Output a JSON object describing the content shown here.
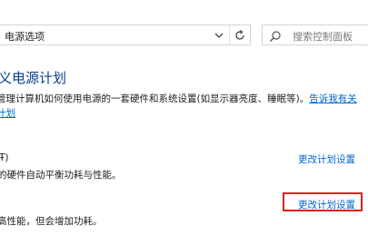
{
  "address_bar": {
    "path": "电源选项"
  },
  "search": {
    "placeholder": "搜索控制面板"
  },
  "page": {
    "title": "义电源计划",
    "description": "管理计算机如何使用电源的一套硬件和系统设置(如显示器亮度、睡眠等)。",
    "description_link": "告诉我有关",
    "description_line2": "计划"
  },
  "plans": [
    {
      "name": "Ŧ)",
      "description": "的硬件自动平衡功耗与性能。",
      "change_label": "更改计划设置"
    },
    {
      "description": "高性能，但会增加功耗。",
      "change_label": "更改计划设置"
    }
  ]
}
